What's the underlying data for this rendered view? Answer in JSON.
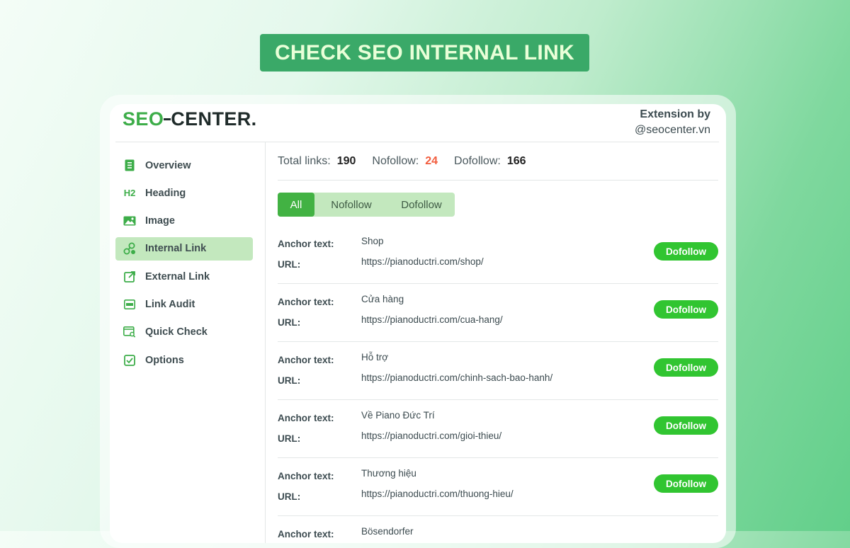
{
  "banner": "CHECK SEO INTERNAL LINK",
  "brand": {
    "logo_seo": "SEO",
    "logo_rest": "CENTER.",
    "extension_line1": "Extension by",
    "extension_line2": "@seocenter.vn"
  },
  "sidebar": {
    "items": [
      {
        "label": "Overview",
        "icon": "document-icon",
        "active": false
      },
      {
        "label": "Heading",
        "icon": "h2-icon",
        "active": false
      },
      {
        "label": "Image",
        "icon": "image-icon",
        "active": false
      },
      {
        "label": "Internal Link",
        "icon": "link-icon",
        "active": true
      },
      {
        "label": "External Link",
        "icon": "external-link-icon",
        "active": false
      },
      {
        "label": "Link Audit",
        "icon": "audit-icon",
        "active": false
      },
      {
        "label": "Quick Check",
        "icon": "quick-check-icon",
        "active": false
      },
      {
        "label": "Options",
        "icon": "checkbox-icon",
        "active": false
      }
    ]
  },
  "stats": {
    "total_label": "Total links:",
    "total": "190",
    "nofollow_label": "Nofollow:",
    "nofollow": "24",
    "dofollow_label": "Dofollow:",
    "dofollow": "166"
  },
  "filters": {
    "all": "All",
    "nofollow": "Nofollow",
    "dofollow": "Dofollow",
    "selected": "All"
  },
  "link_labels": {
    "anchor": "Anchor text:",
    "url": "URL:"
  },
  "links": [
    {
      "anchor": "Shop",
      "url": "https://pianoductri.com/shop/",
      "status": "Dofollow"
    },
    {
      "anchor": "Cửa hàng",
      "url": "https://pianoductri.com/cua-hang/",
      "status": "Dofollow"
    },
    {
      "anchor": "Hỗ trợ",
      "url": "https://pianoductri.com/chinh-sach-bao-hanh/",
      "status": "Dofollow"
    },
    {
      "anchor": "Về Piano Đức Trí",
      "url": "https://pianoductri.com/gioi-thieu/",
      "status": "Dofollow"
    },
    {
      "anchor": "Thương hiệu",
      "url": "https://pianoductri.com/thuong-hieu/",
      "status": "Dofollow"
    },
    {
      "anchor": "Bösendorfer",
      "url": "",
      "status": ""
    }
  ],
  "colors": {
    "accent": "#42b243",
    "badge": "#31c531",
    "nofollow_count": "#f25c3d",
    "banner": "#3aa968"
  }
}
